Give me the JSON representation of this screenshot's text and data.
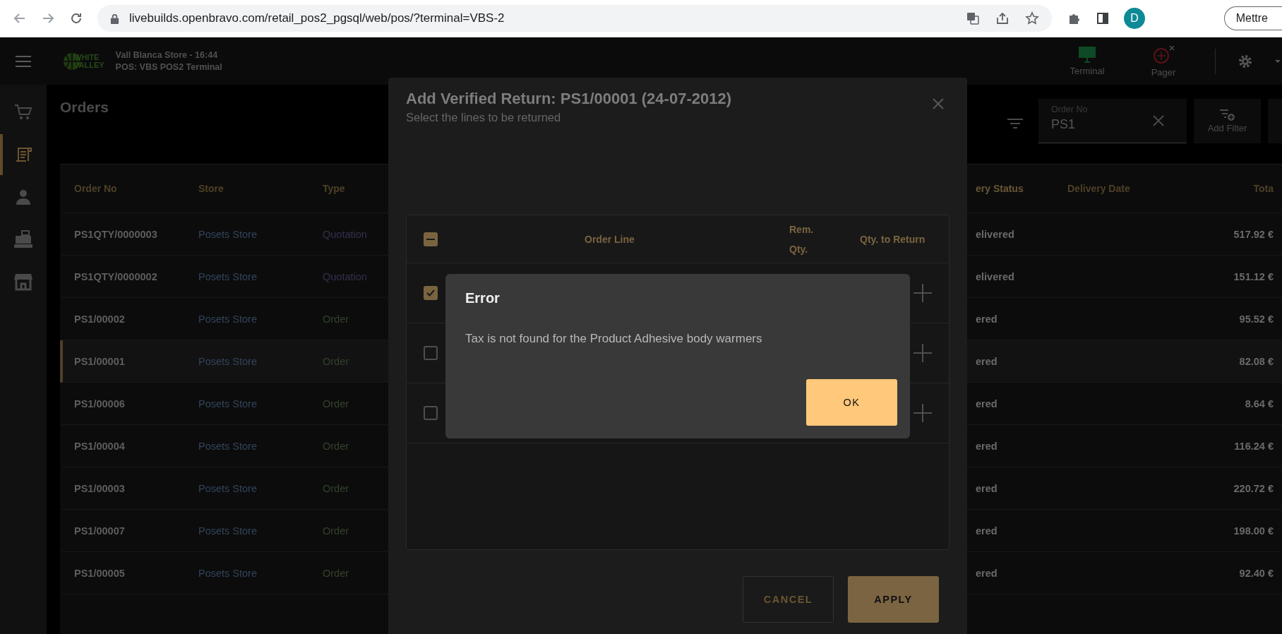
{
  "browser": {
    "url": "livebuilds.openbravo.com/retail_pos2_pgsql/web/pos/?terminal=VBS-2",
    "profile_initial": "D",
    "button": "Mettre"
  },
  "header": {
    "logo": [
      "WHITE",
      "VALLEY"
    ],
    "store_line": "Vall Blanca Store - 16:44",
    "terminal_line": "POS: VBS POS2 Terminal",
    "actions": [
      {
        "kind": "terminal",
        "label": "Terminal"
      },
      {
        "kind": "pager",
        "label": "Pager"
      }
    ]
  },
  "sidebar": {
    "items": [
      {
        "kind": "cart",
        "selected": false
      },
      {
        "kind": "receipt",
        "selected": true
      },
      {
        "kind": "customer",
        "selected": false
      },
      {
        "kind": "register",
        "selected": false
      },
      {
        "kind": "store",
        "selected": false
      }
    ]
  },
  "page": {
    "title": "Orders",
    "filter": {
      "label": "Order No",
      "value": "PS1"
    },
    "add_filter": "Add Filter"
  },
  "table": {
    "columns": {
      "order_no": "Order No",
      "store": "Store",
      "type": "Type",
      "delivery_status": "ery Status",
      "delivery_date": "Delivery Date",
      "total": "Tota"
    },
    "rows": [
      {
        "order_no": "PS1QTY/0000003",
        "store": "Posets Store",
        "type": "Quotation",
        "kind": "quotation",
        "delivery_status": "elivered",
        "total": "517.92 €",
        "selected": false
      },
      {
        "order_no": "PS1QTY/0000002",
        "store": "Posets Store",
        "type": "Quotation",
        "kind": "quotation",
        "delivery_status": "elivered",
        "total": "151.12 €",
        "selected": false
      },
      {
        "order_no": "PS1/00002",
        "store": "Posets Store",
        "type": "Order",
        "kind": "order",
        "delivery_status": "ered",
        "total": "95.52 €",
        "selected": false
      },
      {
        "order_no": "PS1/00001",
        "store": "Posets Store",
        "type": "Order",
        "kind": "order",
        "delivery_status": "ered",
        "total": "82.08 €",
        "selected": true
      },
      {
        "order_no": "PS1/00006",
        "store": "Posets Store",
        "type": "Order",
        "kind": "order",
        "delivery_status": "ered",
        "total": "8.64 €",
        "selected": false
      },
      {
        "order_no": "PS1/00004",
        "store": "Posets Store",
        "type": "Order",
        "kind": "order",
        "delivery_status": "ered",
        "total": "116.24 €",
        "selected": false
      },
      {
        "order_no": "PS1/00003",
        "store": "Posets Store",
        "type": "Order",
        "kind": "order",
        "delivery_status": "ered",
        "total": "220.72 €",
        "selected": false
      },
      {
        "order_no": "PS1/00007",
        "store": "Posets Store",
        "type": "Order",
        "kind": "order",
        "delivery_status": "ered",
        "total": "198.00 €",
        "selected": false
      },
      {
        "order_no": "PS1/00005",
        "store": "Posets Store",
        "type": "Order",
        "kind": "order",
        "delivery_status": "ered",
        "total": "92.40 €",
        "selected": false
      }
    ]
  },
  "dialog": {
    "title": "Add Verified Return: PS1/00001 (24-07-2012)",
    "subtitle": "Select the lines to be returned",
    "columns": {
      "order_line": "Order Line",
      "remaining_qty": "Rem. Qty.",
      "qty_to_return": "Qty. to Return"
    },
    "select_all": {
      "indeterminate": true
    },
    "lines": [
      {
        "checked": true
      },
      {
        "checked": false
      },
      {
        "checked": false
      }
    ],
    "buttons": {
      "cancel": "CANCEL",
      "apply": "APPLY"
    }
  },
  "error": {
    "title": "Error",
    "message": "Tax is not found for the Product Adhesive body warmers",
    "button": "OK"
  }
}
